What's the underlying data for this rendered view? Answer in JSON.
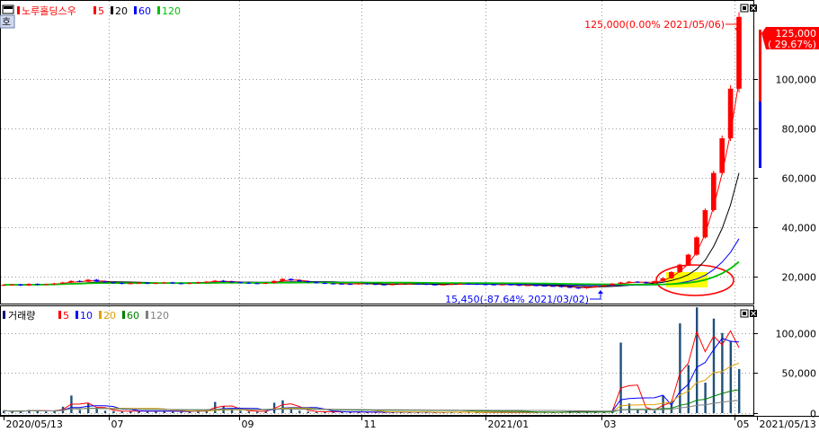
{
  "price_panel": {
    "name": "노루홀딩스우",
    "ma_periods": [
      "5",
      "20",
      "60",
      "120"
    ],
    "ma_colors": [
      "#ff0000",
      "#000000",
      "#0000ff",
      "#00c000"
    ],
    "tag_button": "호",
    "high_annotation": "125,000(0.00% 2021/05/06)",
    "low_annotation": "15,450(-87.64% 2021/03/02)",
    "current_price_label": "125,000",
    "current_change_label": "( 29.67%)"
  },
  "volume_panel": {
    "name": "거래량",
    "ma_periods": [
      "5",
      "10",
      "20",
      "60",
      "120"
    ],
    "ma_colors": [
      "#ff0000",
      "#0000ff",
      "#e0a000",
      "#008000",
      "#808080"
    ]
  },
  "x_axis": {
    "labels": [
      "2020/05/13",
      "07",
      "09",
      "11",
      "2021/01",
      "03",
      "05",
      "2021/05/13"
    ]
  },
  "chart_data": [
    {
      "type": "candlestick",
      "name": "노루홀딩스우",
      "y_ticks": [
        "20,000",
        "40,000",
        "60,000",
        "80,000",
        "100,000"
      ],
      "y_tick_values": [
        20000,
        40000,
        60000,
        80000,
        100000
      ],
      "ylim": [
        10000,
        130000
      ],
      "x_range": [
        "2020/05/13",
        "2021/05/13"
      ],
      "closes": [
        16800,
        17000,
        16600,
        17200,
        16900,
        17100,
        17400,
        17800,
        18400,
        18100,
        18900,
        18200,
        17900,
        17600,
        17300,
        17500,
        17700,
        17400,
        17600,
        17800,
        17500,
        17300,
        17600,
        17900,
        18100,
        18500,
        18200,
        17900,
        17700,
        17500,
        17400,
        17600,
        18400,
        19200,
        18700,
        18300,
        17900,
        17600,
        17400,
        17300,
        17200,
        17100,
        17400,
        17200,
        17000,
        16900,
        17100,
        17200,
        17300,
        17200,
        17000,
        16800,
        17000,
        17200,
        17300,
        17200,
        17100,
        17000,
        16900,
        17000,
        16800,
        16600,
        16700,
        16500,
        16400,
        16300,
        16000,
        15700,
        15450,
        15900,
        16300,
        16700,
        17300,
        17800,
        18100,
        17900,
        17600,
        18300,
        19500,
        22000,
        25000,
        29000,
        36000,
        47000,
        62000,
        76000,
        96000,
        125000
      ],
      "candle_style": {
        "up": "#ff0000",
        "down": "#0000ff"
      },
      "high_marker": {
        "value": 125000,
        "date": "2021/05/06",
        "change": "0.00%"
      },
      "low_marker": {
        "value": 15450,
        "date": "2021/03/02",
        "change": "-87.64%"
      },
      "current": {
        "value": 125000,
        "change": "29.67%"
      }
    },
    {
      "type": "bar",
      "name": "거래량",
      "y_ticks": [
        "0",
        "50,000",
        "100,000"
      ],
      "y_tick_values": [
        0,
        50000,
        100000
      ],
      "ylim": [
        0,
        130000
      ],
      "values": [
        3000,
        2000,
        2500,
        4000,
        3000,
        2000,
        3500,
        8000,
        22000,
        4000,
        12000,
        6000,
        3000,
        2500,
        2000,
        2500,
        3000,
        2000,
        2500,
        3000,
        2000,
        1500,
        2500,
        3500,
        3000,
        14000,
        9000,
        4000,
        3000,
        2000,
        2000,
        2500,
        13000,
        16000,
        6000,
        3000,
        2000,
        1500,
        1500,
        2000,
        1500,
        1200,
        1500,
        1200,
        1000,
        1200,
        1500,
        1200,
        1000,
        1200,
        1000,
        900,
        1000,
        1500,
        1200,
        1000,
        900,
        800,
        900,
        1000,
        900,
        800,
        1200,
        1500,
        1000,
        800,
        1500,
        2500,
        3000,
        2000,
        1500,
        2500,
        3000,
        88000,
        12000,
        5000,
        4000,
        3000,
        22000,
        15000,
        112000,
        60000,
        132000,
        38000,
        118000,
        100000,
        90000,
        55000
      ]
    }
  ]
}
